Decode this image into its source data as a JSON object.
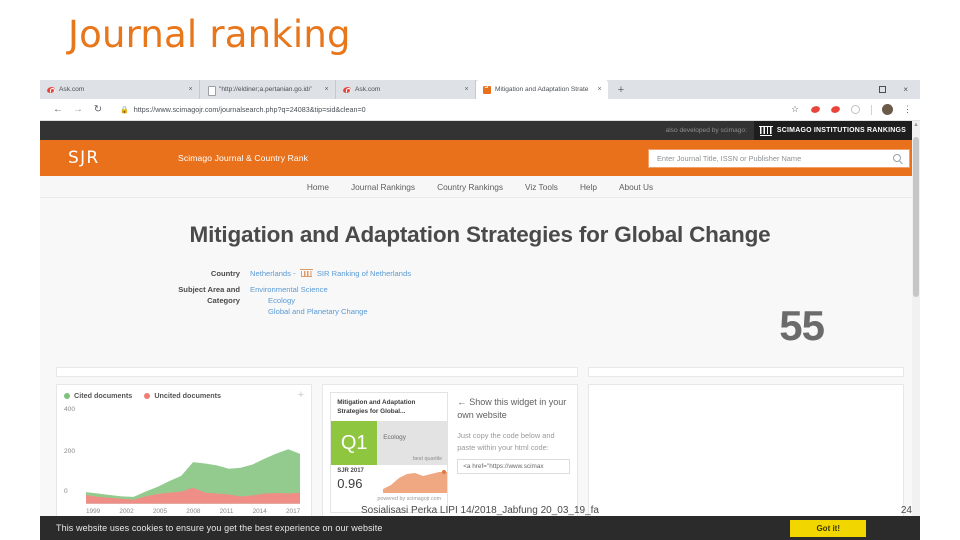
{
  "slide": {
    "title": "Journal ranking",
    "footer_text": "Sosialisasi Perka LIPI 14/2018_Jabfung 20_03_19_fa",
    "page_number": "24",
    "title_color": "#E8761B"
  },
  "browser": {
    "tabs": [
      {
        "title": "Ask.com",
        "favicon": "ask-favicon",
        "close": "×",
        "active": false
      },
      {
        "title": "\"http://eldiner;a.pertanian.go.id/’",
        "favicon": "document-favicon",
        "close": "×",
        "active": false
      },
      {
        "title": "Ask.com",
        "favicon": "ask-favicon",
        "close": "×",
        "active": false
      },
      {
        "title": "Mitigation and Adaptation Strate",
        "favicon": "sjr-favicon",
        "close": "×",
        "active": true
      }
    ],
    "new_tab_label": "+",
    "window_controls": {
      "maximize": "□",
      "close": "×"
    },
    "nav": {
      "back": "←",
      "forward": "→",
      "reload": "↻"
    },
    "address": {
      "lock_icon": "lock-icon",
      "url": "https://www.scimagojr.com/journalsearch.php?q=24083&tip=sid&clean=0"
    },
    "toolbar_icons": [
      "star-icon",
      "ask-extension-icon",
      "ask-extension-icon",
      "circle-extension-icon",
      "avatar",
      "kebab-menu-icon"
    ]
  },
  "site": {
    "top_strip": {
      "developed_by": "also developed by scimago:",
      "sir_label": "SCIMAGO INSTITUTIONS RANKINGS",
      "sir_icon": "pillars-icon"
    },
    "header": {
      "logo": "SJR",
      "subtitle": "Scimago Journal & Country Rank",
      "search_placeholder": "Enter Journal Title, ISSN or Publisher Name",
      "search_value": "",
      "search_icon": "magnifier-icon",
      "accent_color": "#e9711c"
    },
    "nav_items": [
      "Home",
      "Journal Rankings",
      "Country Rankings",
      "Viz Tools",
      "Help",
      "About Us"
    ],
    "journal": {
      "title": "Mitigation and Adaptation Strategies for Global Change",
      "h_index": "55",
      "meta": [
        {
          "label": "Country",
          "value": "Netherlands",
          "separator": "-",
          "link_icon": "pillars-icon",
          "link": "SIR Ranking of Netherlands"
        },
        {
          "label": "Subject Area and Category",
          "value": "Environmental Science",
          "sub": "Ecology",
          "sub2": "Global and Planetary Change"
        }
      ]
    },
    "widget": {
      "arrow": "←",
      "headline": "Show this widget in your own website",
      "body": "Just copy the code below and paste within your html code:",
      "code": "<a href=\"https://www.scimax",
      "preview": {
        "title": "Mitigation and Adaptation Strategies for Global...",
        "quartile": "Q1",
        "category": "Ecology",
        "quartile_note": "best quartile",
        "sjr_label": "SJR 2017",
        "sjr_value": "0.96",
        "powered_by": "powered by scimagojr.com",
        "quartile_color": "#8ec640",
        "spark_color": "#f0a882"
      }
    },
    "cookie_banner": {
      "text": "This website uses cookies to ensure you get the best experience on our website",
      "button": "Got it!",
      "button_color": "#f2d600"
    }
  },
  "chart_data": {
    "type": "area",
    "title": "",
    "xlabel": "",
    "ylabel": "",
    "legend": [
      {
        "name": "Cited documents",
        "color": "#7ec27e"
      },
      {
        "name": "Uncited documents",
        "color": "#ef7d74"
      }
    ],
    "legend_position": "top-left",
    "grid": false,
    "yticks": [
      "400",
      "200",
      "0"
    ],
    "ylim": [
      0,
      420
    ],
    "xticks": [
      "1999",
      "2002",
      "2005",
      "2008",
      "2011",
      "2014",
      "2017"
    ],
    "x": [
      1999,
      2000,
      2001,
      2002,
      2003,
      2004,
      2005,
      2006,
      2007,
      2008,
      2009,
      2010,
      2011,
      2012,
      2013,
      2014,
      2015,
      2016,
      2017
    ],
    "series": [
      {
        "name": "Uncited documents",
        "color": "#ef7d74",
        "values": [
          38,
          30,
          26,
          22,
          18,
          32,
          42,
          48,
          52,
          68,
          48,
          44,
          40,
          32,
          36,
          44,
          46,
          44,
          48
        ]
      },
      {
        "name": "Cited documents",
        "color": "#7ec27e",
        "values": [
          50,
          44,
          38,
          32,
          30,
          52,
          72,
          96,
          118,
          176,
          170,
          162,
          148,
          152,
          166,
          190,
          212,
          230,
          210
        ]
      }
    ],
    "add_button": "+"
  }
}
